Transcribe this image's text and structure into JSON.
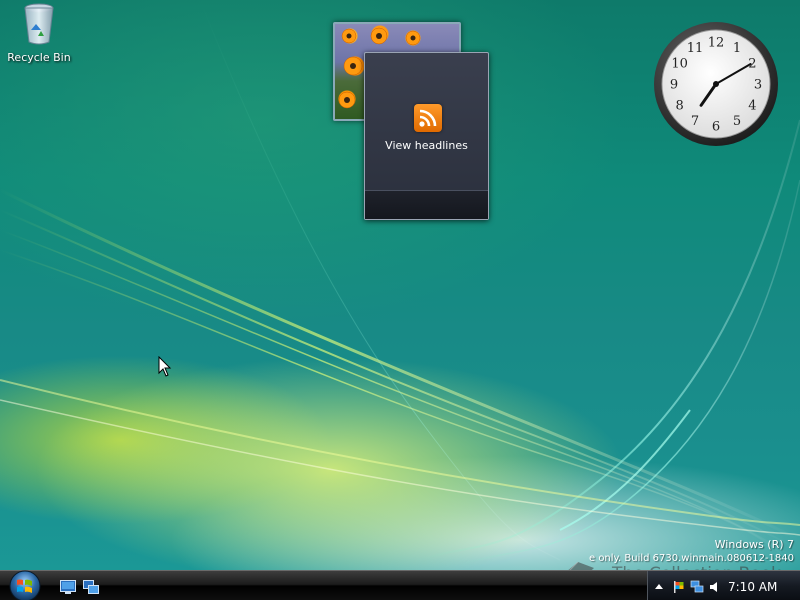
{
  "desktop": {
    "icons": [
      {
        "label": "Recycle Bin",
        "icon": "recycle-bin-icon"
      }
    ]
  },
  "gadgets": {
    "slideshow": {
      "image": "orange-flowers-photo"
    },
    "feed": {
      "label": "View headlines",
      "icon": "rss-icon",
      "accent_color": "#f28c1e"
    },
    "clock": {
      "hour": 7,
      "minute": 10,
      "numerals": [
        "12",
        "1",
        "2",
        "3",
        "4",
        "5",
        "6",
        "7",
        "8",
        "9",
        "10",
        "11"
      ]
    }
  },
  "watermark": {
    "line1": "Windows (R) 7",
    "line2": "e only. Build 6730.winmain.080612-1840"
  },
  "site_watermark": {
    "text": "The Collection Book",
    "icon": "book-icon"
  },
  "taskbar": {
    "start": {
      "icon": "windows-logo-icon"
    },
    "quick_launch": [
      {
        "name": "Show desktop",
        "icon": "show-desktop-icon"
      },
      {
        "name": "Switch between windows",
        "icon": "switch-windows-icon"
      }
    ],
    "tray": {
      "icons": [
        "chevron-up-icon",
        "action-center-flag-icon",
        "network-icon",
        "volume-icon"
      ],
      "time": "7:10 AM"
    }
  },
  "colors": {
    "desktop_base": "#0f8a7a",
    "taskbar": "#1b1b1b",
    "rss_orange": "#f28c1e"
  }
}
